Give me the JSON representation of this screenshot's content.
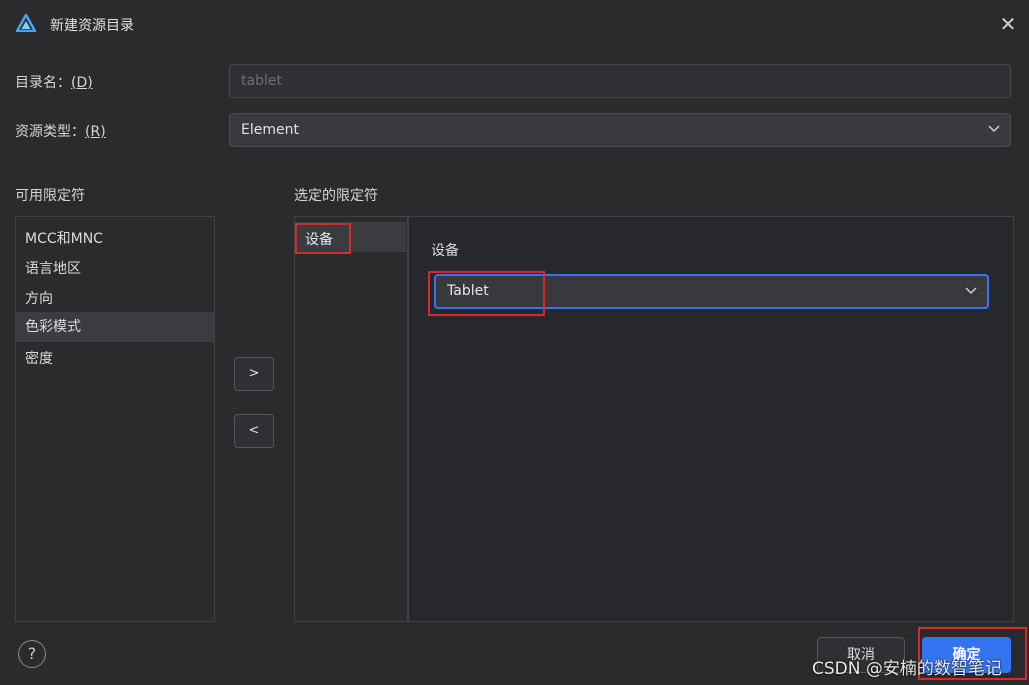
{
  "window": {
    "title": "新建资源目录",
    "close_symbol": "✕"
  },
  "form": {
    "dir_label": "目录名：",
    "dir_key": "(D)",
    "dir_value": "tablet",
    "type_label": "资源类型：",
    "type_key": "(R)",
    "type_value": "Element"
  },
  "available": {
    "header": "可用限定符",
    "items": [
      "MCC和MNC",
      "语言地区",
      "方向",
      "色彩模式",
      "密度"
    ],
    "selected_index": 3
  },
  "buttons": {
    "add": ">",
    "remove": "<",
    "cancel": "取消",
    "ok": "确定",
    "help": "?"
  },
  "selected": {
    "header": "选定的限定符",
    "items": [
      "设备"
    ]
  },
  "detail": {
    "label": "设备",
    "value": "Tablet"
  },
  "watermark": "CSDN @安楠的数智笔记",
  "colors": {
    "accent": "#3574f0",
    "highlight_box": "#d32a2a",
    "background": "#2b2b2e"
  }
}
